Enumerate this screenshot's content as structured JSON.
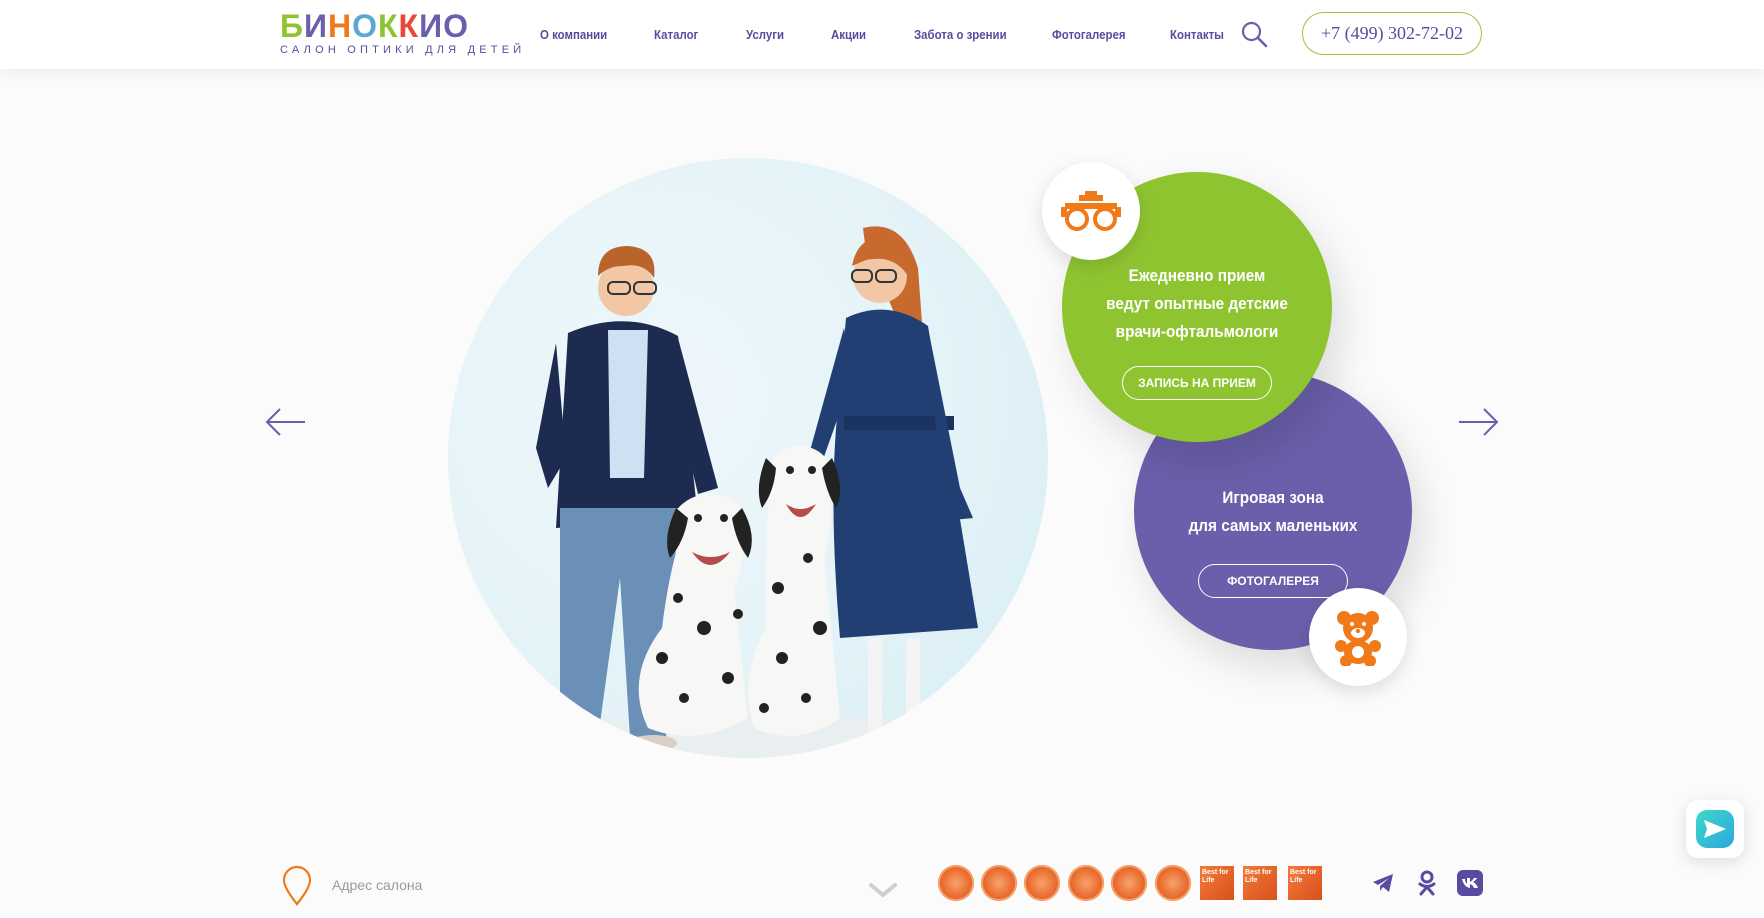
{
  "logo": {
    "word": "БИНОККИО",
    "letters": [
      {
        "ch": "Б",
        "color": "#8fc431"
      },
      {
        "ch": "И",
        "color": "#6a5faa"
      },
      {
        "ch": "Н",
        "color": "#f07a1a"
      },
      {
        "ch": "О",
        "color": "#5aa7d6"
      },
      {
        "ch": "К",
        "color": "#8fc431"
      },
      {
        "ch": "К",
        "color": "#e8473a"
      },
      {
        "ch": "И",
        "color": "#6a5faa"
      },
      {
        "ch": "О",
        "color": "#6a5faa"
      }
    ],
    "subtitle": "САЛОН ОПТИКИ ДЛЯ ДЕТЕЙ"
  },
  "nav": {
    "items": [
      {
        "label": "О компании"
      },
      {
        "label": "Каталог"
      },
      {
        "label": "Услуги"
      },
      {
        "label": "Акции"
      },
      {
        "label": "Забота о зрении"
      },
      {
        "label": "Фотогалерея"
      },
      {
        "label": "Контакты"
      }
    ]
  },
  "header": {
    "phone": "+7 (499) 302-72-02",
    "search_icon": "search-icon"
  },
  "hero": {
    "green_card": {
      "lines": [
        "Ежедневно прием",
        "ведут опытные детские",
        "врачи-офтальмологи"
      ],
      "button": "ЗАПИСЬ НА ПРИЕМ",
      "icon": "trial-frame-glasses-icon"
    },
    "purple_card": {
      "lines": [
        "Игровая зона",
        "для самых маленьких"
      ],
      "button": "ФОТОГАЛЕРЕЯ",
      "icon": "teddy-bear-icon"
    }
  },
  "footer": {
    "address_label": "Адрес салона",
    "award_square_text": "Best for Life",
    "awards_round_count": 6,
    "awards_square_count": 3,
    "socials": [
      "telegram-icon",
      "odnoklassniki-icon",
      "vk-icon"
    ]
  },
  "colors": {
    "brand_purple": "#6a5faa",
    "brand_green": "#8fc431",
    "accent_orange": "#f07a1a",
    "nav_text": "#5a4ba0"
  }
}
